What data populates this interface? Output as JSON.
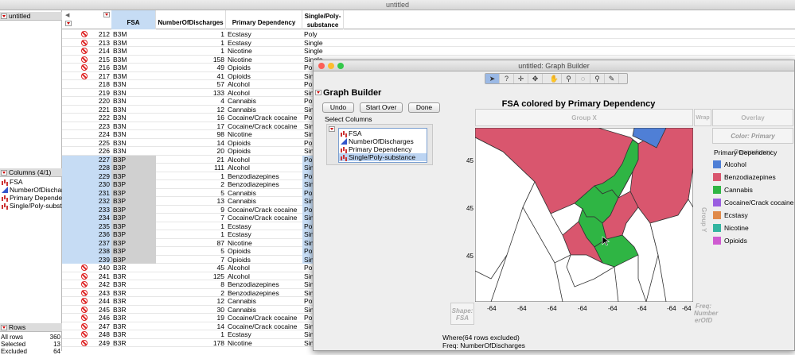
{
  "window_title": "untitled",
  "left_panel": {
    "table_name": "untitled",
    "columns_header": "Columns (4/1)",
    "columns": [
      {
        "name": "FSA",
        "type": "nominal"
      },
      {
        "name": "NumberOfDischarges",
        "type": "continuous"
      },
      {
        "name": "Primary Dependency",
        "type": "nominal"
      },
      {
        "name": "Single/Poly-substance",
        "type": "nominal"
      }
    ],
    "rows_header": "Rows",
    "rows_stats": [
      {
        "label": "All rows",
        "value": "360"
      },
      {
        "label": "Selected",
        "value": "13"
      },
      {
        "label": "Excluded",
        "value": "64"
      }
    ]
  },
  "table": {
    "headers": {
      "fsa": "FSA",
      "num": "NumberOfDischarges",
      "dep": "Primary Dependency",
      "st1": "Single/Poly-",
      "st2": "substance"
    },
    "rows": [
      {
        "n": "212",
        "fsa": "B3M",
        "num": "1",
        "dep": "Ecstasy",
        "st": "Poly",
        "ex": true,
        "sel": false
      },
      {
        "n": "213",
        "fsa": "B3M",
        "num": "1",
        "dep": "Ecstasy",
        "st": "Single",
        "ex": true,
        "sel": false
      },
      {
        "n": "214",
        "fsa": "B3M",
        "num": "1",
        "dep": "Nicotine",
        "st": "Single",
        "ex": true,
        "sel": false
      },
      {
        "n": "215",
        "fsa": "B3M",
        "num": "158",
        "dep": "Nicotine",
        "st": "Single",
        "ex": true,
        "sel": false
      },
      {
        "n": "216",
        "fsa": "B3M",
        "num": "49",
        "dep": "Opioids",
        "st": "Poly",
        "ex": true,
        "sel": false
      },
      {
        "n": "217",
        "fsa": "B3M",
        "num": "41",
        "dep": "Opioids",
        "st": "Sing",
        "ex": true,
        "sel": false
      },
      {
        "n": "218",
        "fsa": "B3N",
        "num": "57",
        "dep": "Alcohol",
        "st": "Poly",
        "ex": false,
        "sel": false
      },
      {
        "n": "219",
        "fsa": "B3N",
        "num": "133",
        "dep": "Alcohol",
        "st": "Sing",
        "ex": false,
        "sel": false
      },
      {
        "n": "220",
        "fsa": "B3N",
        "num": "4",
        "dep": "Cannabis",
        "st": "Poly",
        "ex": false,
        "sel": false
      },
      {
        "n": "221",
        "fsa": "B3N",
        "num": "12",
        "dep": "Cannabis",
        "st": "Sing",
        "ex": false,
        "sel": false
      },
      {
        "n": "222",
        "fsa": "B3N",
        "num": "16",
        "dep": "Cocaine/Crack cocaine",
        "st": "Poly",
        "ex": false,
        "sel": false
      },
      {
        "n": "223",
        "fsa": "B3N",
        "num": "17",
        "dep": "Cocaine/Crack cocaine",
        "st": "Sing",
        "ex": false,
        "sel": false
      },
      {
        "n": "224",
        "fsa": "B3N",
        "num": "98",
        "dep": "Nicotine",
        "st": "Sing",
        "ex": false,
        "sel": false
      },
      {
        "n": "225",
        "fsa": "B3N",
        "num": "14",
        "dep": "Opioids",
        "st": "Poly",
        "ex": false,
        "sel": false
      },
      {
        "n": "226",
        "fsa": "B3N",
        "num": "20",
        "dep": "Opioids",
        "st": "Sing",
        "ex": false,
        "sel": false
      },
      {
        "n": "227",
        "fsa": "B3P",
        "num": "21",
        "dep": "Alcohol",
        "st": "Poly",
        "ex": false,
        "sel": true
      },
      {
        "n": "228",
        "fsa": "B3P",
        "num": "111",
        "dep": "Alcohol",
        "st": "Sing",
        "ex": false,
        "sel": true
      },
      {
        "n": "229",
        "fsa": "B3P",
        "num": "1",
        "dep": "Benzodiazepines",
        "st": "Poly",
        "ex": false,
        "sel": true
      },
      {
        "n": "230",
        "fsa": "B3P",
        "num": "2",
        "dep": "Benzodiazepines",
        "st": "Sing",
        "ex": false,
        "sel": true
      },
      {
        "n": "231",
        "fsa": "B3P",
        "num": "5",
        "dep": "Cannabis",
        "st": "Poly",
        "ex": false,
        "sel": true
      },
      {
        "n": "232",
        "fsa": "B3P",
        "num": "13",
        "dep": "Cannabis",
        "st": "Sing",
        "ex": false,
        "sel": true
      },
      {
        "n": "233",
        "fsa": "B3P",
        "num": "9",
        "dep": "Cocaine/Crack cocaine",
        "st": "Poly",
        "ex": false,
        "sel": true
      },
      {
        "n": "234",
        "fsa": "B3P",
        "num": "7",
        "dep": "Cocaine/Crack cocaine",
        "st": "Sing",
        "ex": false,
        "sel": true
      },
      {
        "n": "235",
        "fsa": "B3P",
        "num": "1",
        "dep": "Ecstasy",
        "st": "Poly",
        "ex": false,
        "sel": true
      },
      {
        "n": "236",
        "fsa": "B3P",
        "num": "1",
        "dep": "Ecstasy",
        "st": "Sing",
        "ex": false,
        "sel": true
      },
      {
        "n": "237",
        "fsa": "B3P",
        "num": "87",
        "dep": "Nicotine",
        "st": "Sing",
        "ex": false,
        "sel": true
      },
      {
        "n": "238",
        "fsa": "B3P",
        "num": "5",
        "dep": "Opioids",
        "st": "Poly",
        "ex": false,
        "sel": true
      },
      {
        "n": "239",
        "fsa": "B3P",
        "num": "7",
        "dep": "Opioids",
        "st": "Sing",
        "ex": false,
        "sel": true
      },
      {
        "n": "240",
        "fsa": "B3R",
        "num": "45",
        "dep": "Alcohol",
        "st": "Poly",
        "ex": true,
        "sel": false
      },
      {
        "n": "241",
        "fsa": "B3R",
        "num": "125",
        "dep": "Alcohol",
        "st": "Sing",
        "ex": true,
        "sel": false
      },
      {
        "n": "242",
        "fsa": "B3R",
        "num": "8",
        "dep": "Benzodiazepines",
        "st": "Sing",
        "ex": true,
        "sel": false
      },
      {
        "n": "243",
        "fsa": "B3R",
        "num": "2",
        "dep": "Benzodiazepines",
        "st": "Sing",
        "ex": true,
        "sel": false
      },
      {
        "n": "244",
        "fsa": "B3R",
        "num": "12",
        "dep": "Cannabis",
        "st": "Poly",
        "ex": true,
        "sel": false
      },
      {
        "n": "245",
        "fsa": "B3R",
        "num": "30",
        "dep": "Cannabis",
        "st": "Sing",
        "ex": true,
        "sel": false
      },
      {
        "n": "246",
        "fsa": "B3R",
        "num": "19",
        "dep": "Cocaine/Crack cocaine",
        "st": "Poly",
        "ex": true,
        "sel": false
      },
      {
        "n": "247",
        "fsa": "B3R",
        "num": "14",
        "dep": "Cocaine/Crack cocaine",
        "st": "Sing",
        "ex": true,
        "sel": false
      },
      {
        "n": "248",
        "fsa": "B3R",
        "num": "1",
        "dep": "Ecstasy",
        "st": "Sing",
        "ex": true,
        "sel": false
      },
      {
        "n": "249",
        "fsa": "B3R",
        "num": "178",
        "dep": "Nicotine",
        "st": "Sing",
        "ex": true,
        "sel": false
      }
    ]
  },
  "graph_builder": {
    "window_title": "untitled: Graph Builder",
    "heading": "Graph Builder",
    "buttons": {
      "undo": "Undo",
      "start_over": "Start Over",
      "done": "Done"
    },
    "select_columns": "Select Columns",
    "column_list": [
      "FSA",
      "NumberOfDischarges",
      "Primary Dependency",
      "Single/Poly-substance"
    ],
    "chart_title": "FSA colored by Primary Dependency",
    "zones": {
      "group_x": "Group X",
      "wrap": "Wrap",
      "overlay": "Overlay",
      "color": "Color: Primary Dependency",
      "group_y": "Group Y",
      "shape1": "Shape:",
      "shape2": "FSA",
      "freq1": "Freq:",
      "freq2": "Number",
      "freq3": "erOfD"
    },
    "y_ticks": [
      "45",
      "45",
      "45"
    ],
    "x_ticks": [
      "-64",
      "-64",
      "-64",
      "-64",
      "-64",
      "-64",
      "-64",
      "-64"
    ],
    "legend_title": "Primary Dependency",
    "legend": [
      {
        "label": "Alcohol",
        "color": "#4f7fd6"
      },
      {
        "label": "Benzodiazepines",
        "color": "#d9566e"
      },
      {
        "label": "Cannabis",
        "color": "#2fb544"
      },
      {
        "label": "Cocaine/Crack cocaine",
        "color": "#9a5ee0"
      },
      {
        "label": "Ecstasy",
        "color": "#e08a4a"
      },
      {
        "label": "Nicotine",
        "color": "#33b5a0"
      },
      {
        "label": "Opioids",
        "color": "#cf5bd1"
      }
    ],
    "footer": {
      "where": "Where(64 rows excluded)",
      "freq": "Freq: NumberOfDischarges"
    }
  }
}
